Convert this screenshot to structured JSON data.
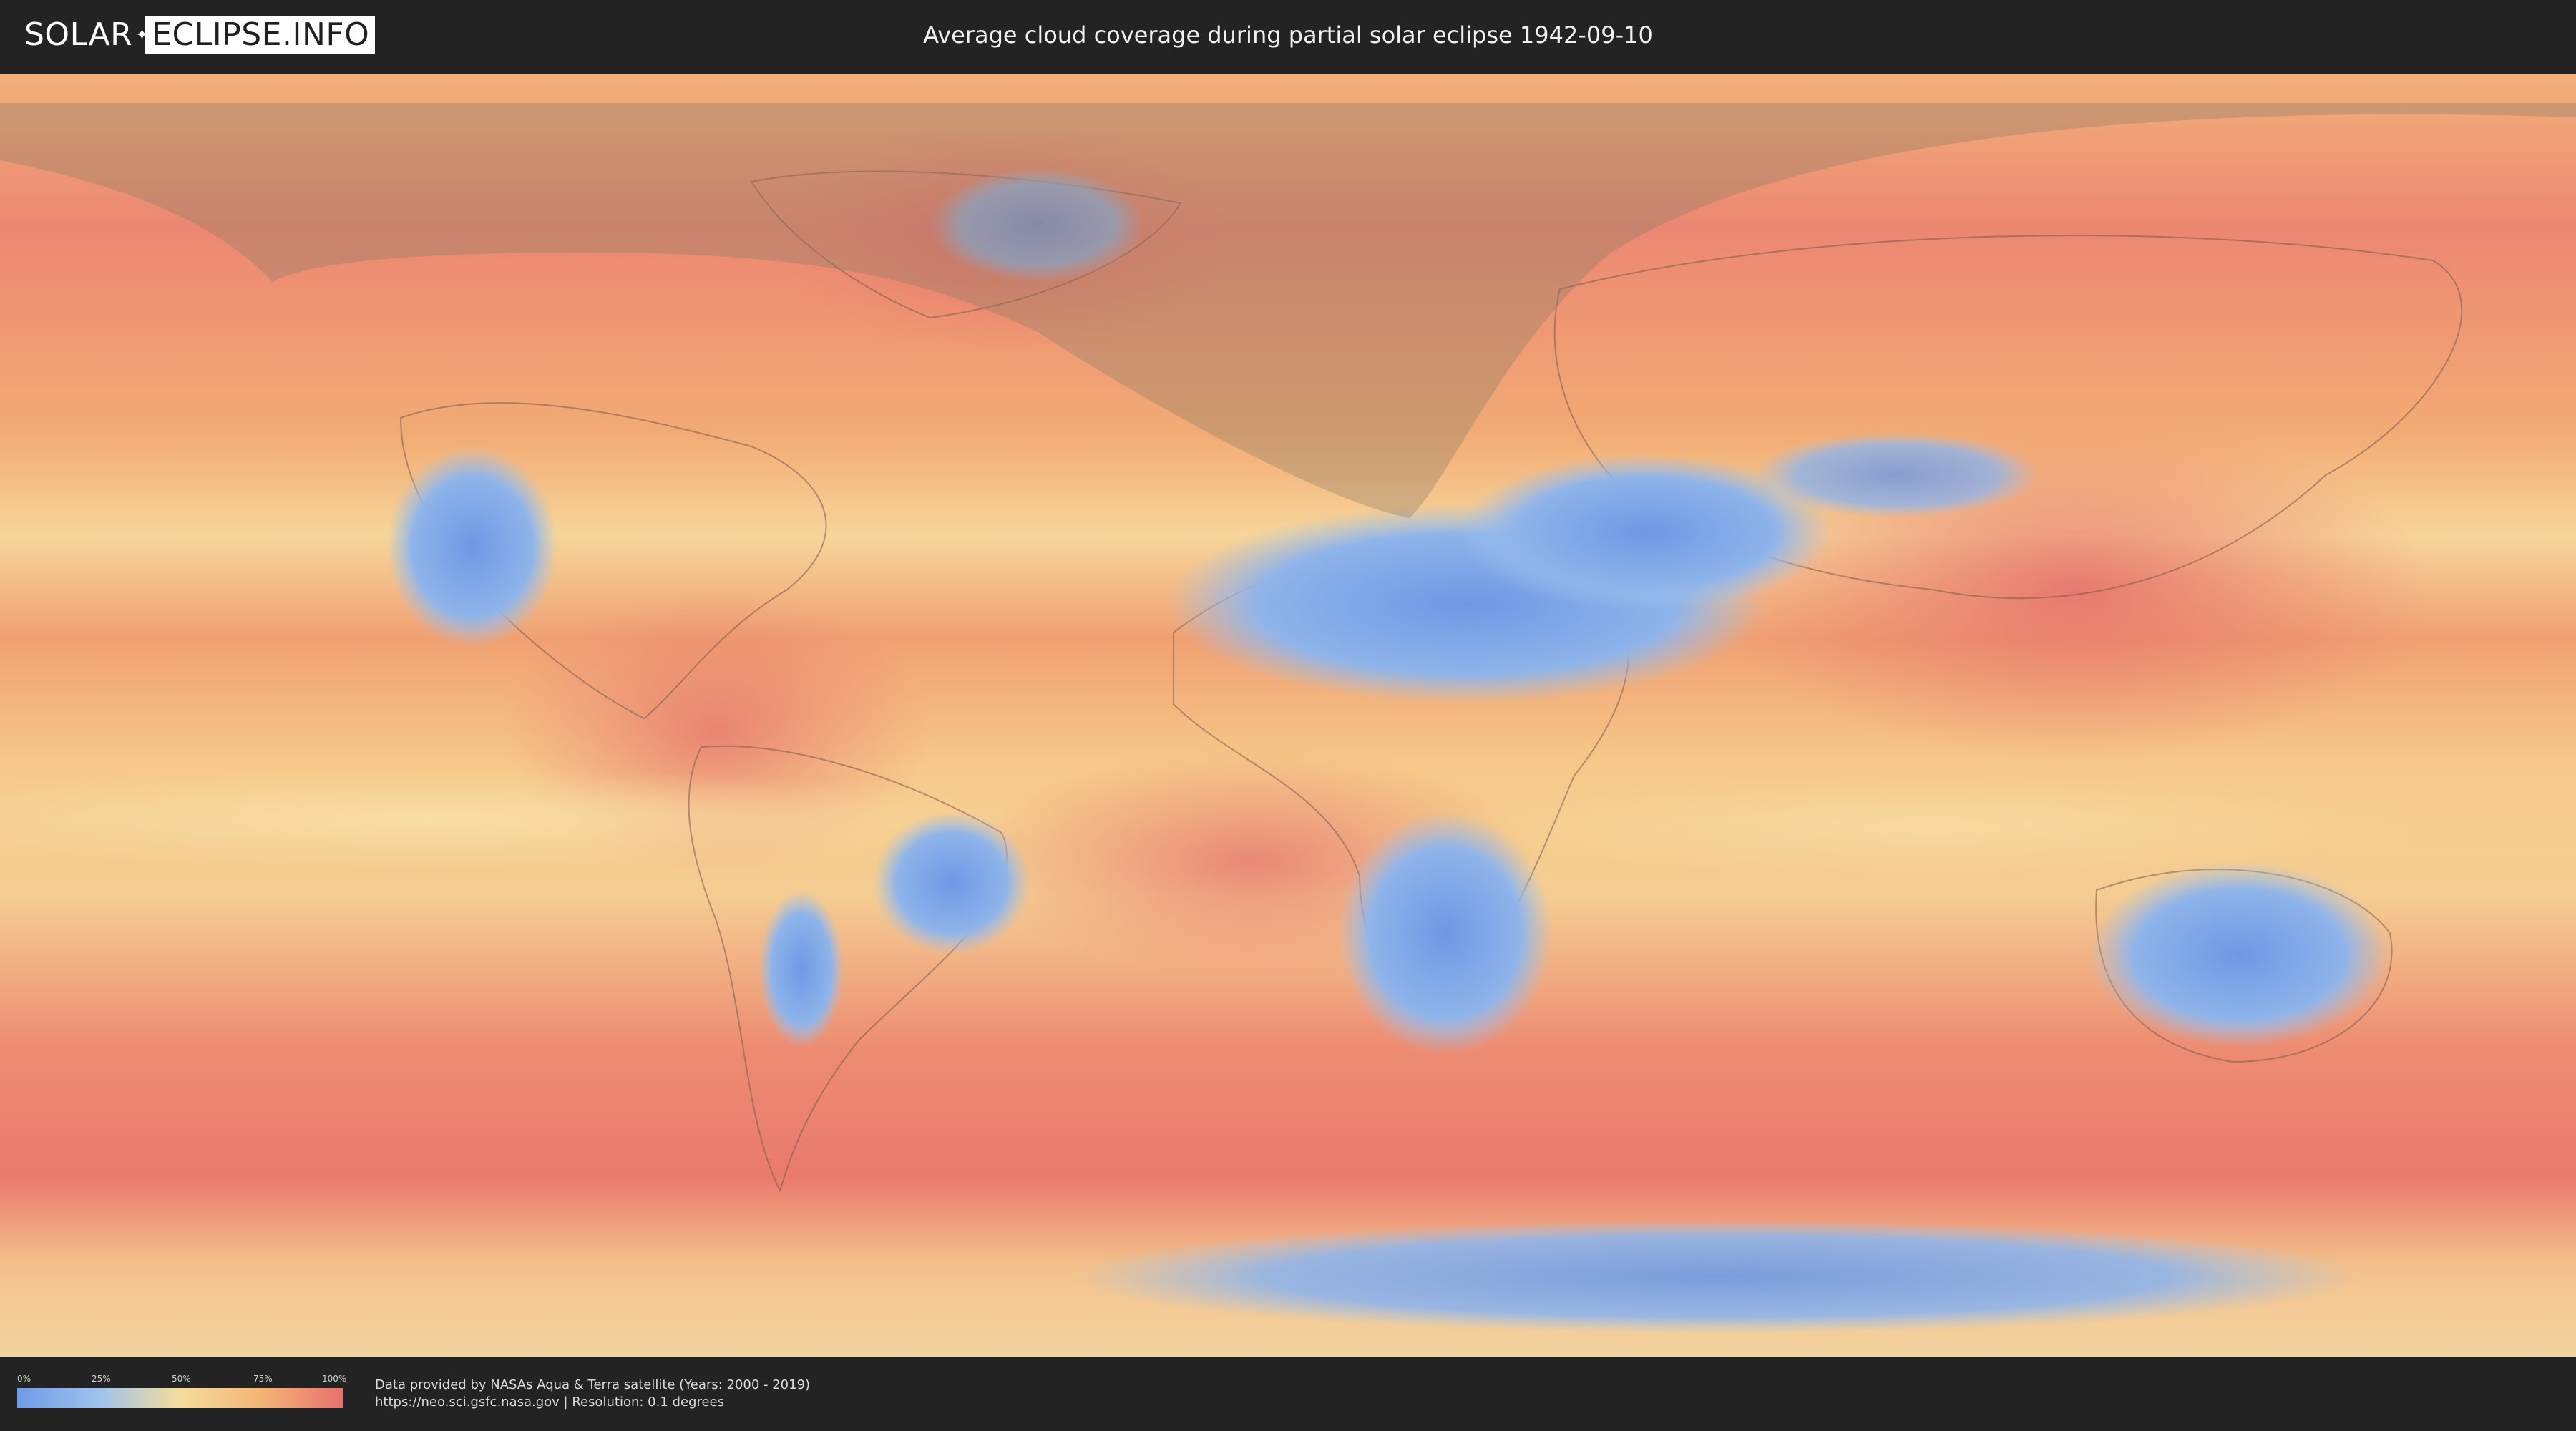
{
  "header": {
    "logo_part1": "SOLAR",
    "logo_part2": "ECLIPSE.INFO",
    "title": "Average cloud coverage during partial solar eclipse 1942-09-10"
  },
  "map": {
    "icon": "world-cloud-map",
    "colors": {
      "clear": "#6f9be6",
      "partly": "#f5dc9c",
      "cloudy": "#e9706f",
      "eclipse_zone": "#8a7a63"
    }
  },
  "legend": {
    "ticks": [
      "0%",
      "25%",
      "50%",
      "75%",
      "100%"
    ],
    "colors": [
      "#6f9be6",
      "#9ec3ec",
      "#f5dc9c",
      "#f3b574",
      "#e9706f"
    ]
  },
  "footer": {
    "credit_line1": "Data provided by NASAs Aqua & Terra satellite (Years: 2000 - 2019)",
    "credit_line2": "https://neo.sci.gsfc.nasa.gov | Resolution: 0.1 degrees"
  }
}
